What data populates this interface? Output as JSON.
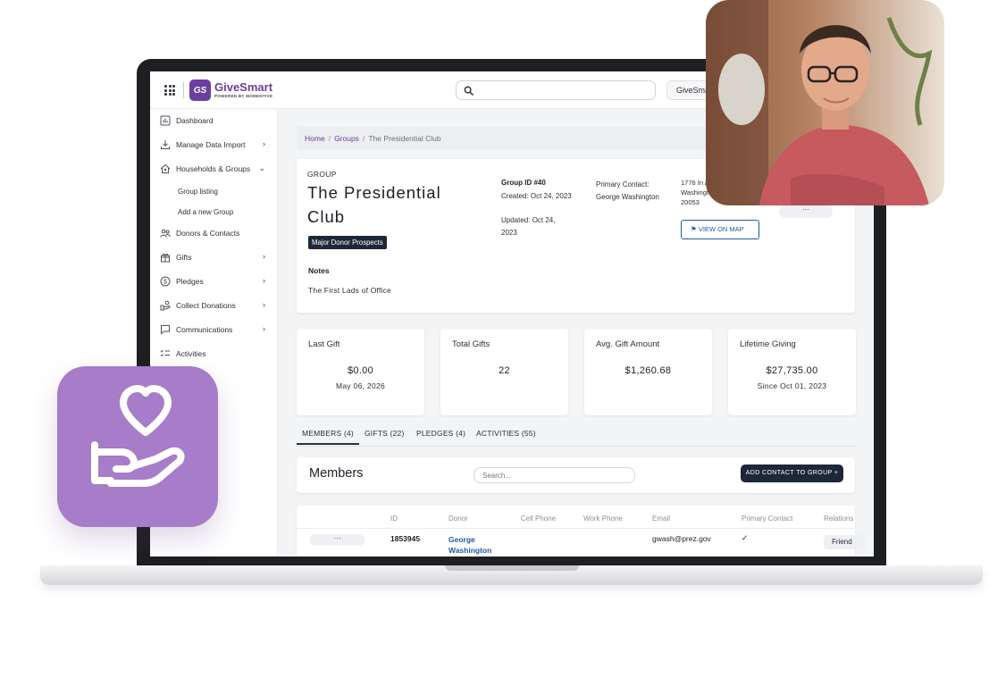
{
  "app": {
    "brand_name": "GiveSmart",
    "brand_sub": "POWERED BY MOMENTIVE",
    "brand_initials": "GS",
    "org_button": "GiveSmart"
  },
  "sidebar": {
    "items": [
      {
        "label": "Dashboard",
        "icon": "dashboard-icon"
      },
      {
        "label": "Manage Data Import",
        "icon": "download-icon",
        "chevron": "›"
      },
      {
        "label": "Households & Groups",
        "icon": "households-icon",
        "chevron": "⌄"
      },
      {
        "label": "Donors & Contacts",
        "icon": "contacts-icon"
      },
      {
        "label": "Gifts",
        "icon": "gift-icon",
        "chevron": "›"
      },
      {
        "label": "Pledges",
        "icon": "dollar-icon",
        "chevron": "›"
      },
      {
        "label": "Collect Donations",
        "icon": "collect-icon",
        "chevron": "›"
      },
      {
        "label": "Communications",
        "icon": "chat-icon",
        "chevron": "›"
      },
      {
        "label": "Activities",
        "icon": "checklist-icon"
      }
    ],
    "sub_items": [
      "Group listing",
      "Add a new Group"
    ]
  },
  "breadcrumb": {
    "home": "Home",
    "sep": "/",
    "groups": "Groups",
    "current": "The Presidential Club"
  },
  "group": {
    "label": "GROUP",
    "title": "The Presidential Club",
    "tag": "Major Donor Prospects",
    "notes_label": "Notes",
    "notes": "The First Lads of Office",
    "group_id": "Group ID #40",
    "created": "Created: Oct 24, 2023",
    "updated": "Updated: Oct 24, 2023",
    "primary_contact": "Primary Contact: George Washington",
    "address": "1776 In Ave Washington 20053",
    "map_button": "VIEW ON MAP",
    "more_button": "···"
  },
  "stats": [
    {
      "title": "Last Gift",
      "value": "$0.00",
      "sub": "May 06, 2026"
    },
    {
      "title": "Total Gifts",
      "value": "22",
      "sub": ""
    },
    {
      "title": "Avg. Gift Amount",
      "value": "$1,260.68",
      "sub": ""
    },
    {
      "title": "Lifetime Giving",
      "value": "$27,735.00",
      "sub": "Since Oct 01, 2023"
    }
  ],
  "tabs": [
    "MEMBERS (4)",
    "GIFTS (22)",
    "PLEDGES (4)",
    "ACTIVITIES (55)"
  ],
  "members": {
    "title": "Members",
    "search_placeholder": "Search...",
    "add_button": "ADD CONTACT TO GROUP +",
    "columns": [
      "ID",
      "Donor",
      "Cell Phone",
      "Work Phone",
      "Email",
      "Primary Contact",
      "Relations"
    ],
    "rows": [
      {
        "more": "···",
        "id": "1853945",
        "donor": "George Washington",
        "cell": "",
        "work": "",
        "email": "gwash@prez.gov",
        "primary": "✓",
        "relation": "Friend"
      }
    ]
  },
  "colors": {
    "brand": "#6b3fa0",
    "dark_badge": "#1d2738",
    "link_blue": "#1f5aa8",
    "icon_tile": "#a77cc8"
  }
}
